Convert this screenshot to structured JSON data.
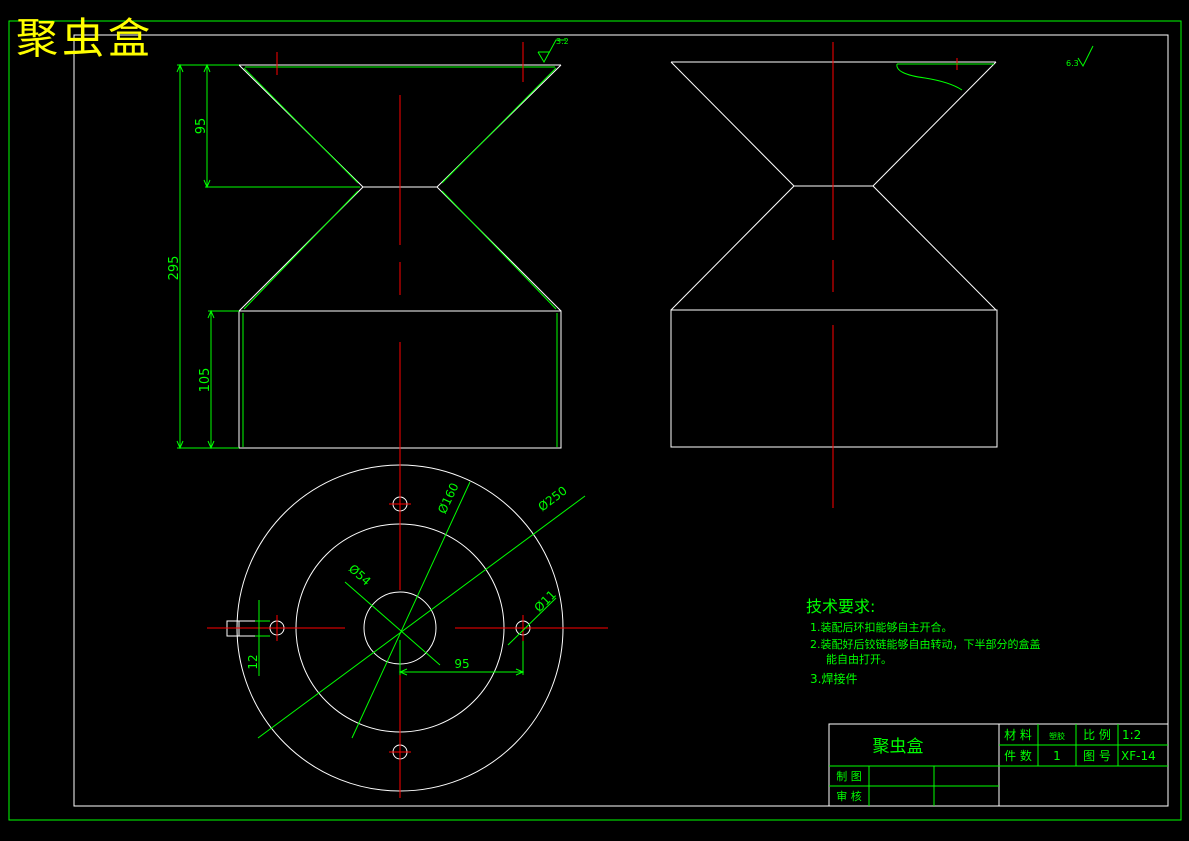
{
  "title_banner": "聚虫盒",
  "colors": {
    "background": "#000000",
    "outline": "#ffffff",
    "centerline": "#ff0000",
    "dimension": "#00ff00",
    "title": "#ffff00"
  },
  "dimensions": {
    "d95_top": "95",
    "d295": "295",
    "d105": "105",
    "dia160": "Ø160",
    "dia250": "Ø250",
    "dia54": "Ø54",
    "dia11": "Ø11",
    "d95_plan": "95",
    "d12": "12",
    "roughness_left": "3.2",
    "roughness_right": "6.3"
  },
  "tech_requirements": {
    "heading": "技术要求:",
    "items": [
      "1.装配后环扣能够自主开合。",
      "2.装配好后铰链能够自由转动，下半部分的盒盖",
      "能自由打开。",
      "3.焊接件"
    ]
  },
  "title_block": {
    "part_name": "聚虫盒",
    "material_label": "材 料",
    "material_value": "塑胶",
    "scale_label": "比 例",
    "scale_value": "1:2",
    "quantity_label": "件 数",
    "quantity_value": "1",
    "drawing_no_label": "图 号",
    "drawing_no_value": "XF-14",
    "drawn_by_label": "制 图",
    "checked_by_label": "审 核"
  }
}
